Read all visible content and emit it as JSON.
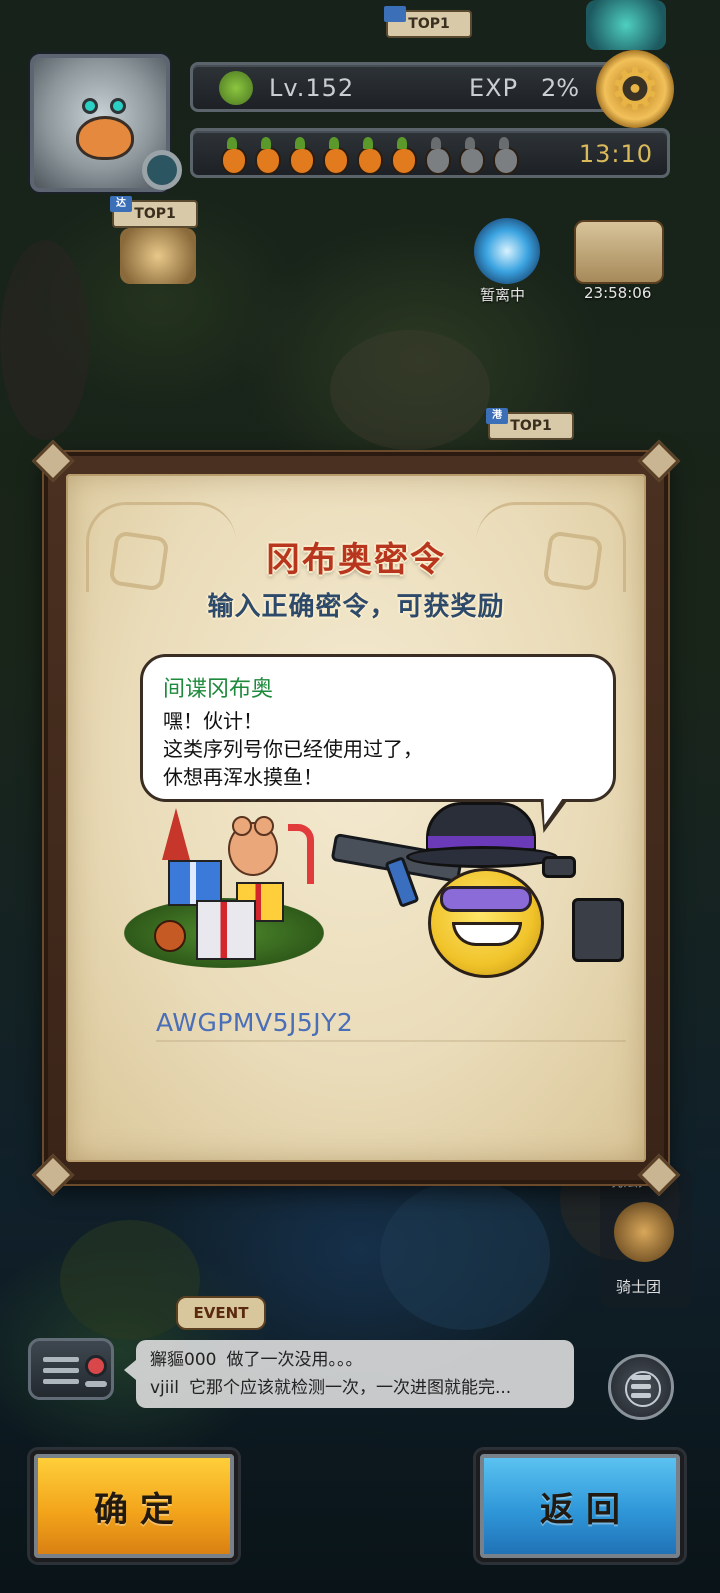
{
  "hud": {
    "level": "Lv.152",
    "exp_label": "EXP",
    "exp_value": "2%",
    "stamina": {
      "filled": 6,
      "total": 9
    },
    "timer": "13:10"
  },
  "map": {
    "top_badges": [
      {
        "tag": "达",
        "label": "TOP1"
      },
      {
        "tag": "港",
        "label": "TOP1"
      },
      {
        "tag": "",
        "label": "TOP1"
      }
    ],
    "portal_label": "暂离中",
    "chest_timer": "23:58:06",
    "event_label": "EVENT",
    "guide_label": "玩法大厅",
    "knight_label": "骑士团"
  },
  "dialog": {
    "title": "冈布奥密令",
    "subtitle": "输入正确密令，可获奖励",
    "speaker": "间谍冈布奥",
    "lines": [
      "嘿！伙计！",
      "这类序列号你已经使用过了，",
      "休想再浑水摸鱼！"
    ],
    "code_value": "AWGPMV5J5JY2"
  },
  "chat": [
    {
      "user": "獬貙000",
      "text": "做了一次没用。。。"
    },
    {
      "user": "vjiil",
      "text": "它那个应该就检测一次，一次进图就能完..."
    }
  ],
  "buttons": {
    "confirm": "确定",
    "back": "返回"
  },
  "icons": [
    "settings-gear-icon",
    "clover-icon",
    "carrot-icon",
    "portal-icon",
    "treasure-chest-icon",
    "radio-icon",
    "menu-icon",
    "guild-emblem-icon"
  ],
  "colors": {
    "title_red": "#b8361e",
    "subtitle_blue": "#2e4a6a",
    "speaker_green": "#1e8a3c",
    "code_blue": "#4a6fb8",
    "confirm_yellow": "#f3a51b",
    "back_blue": "#2f97d8"
  }
}
